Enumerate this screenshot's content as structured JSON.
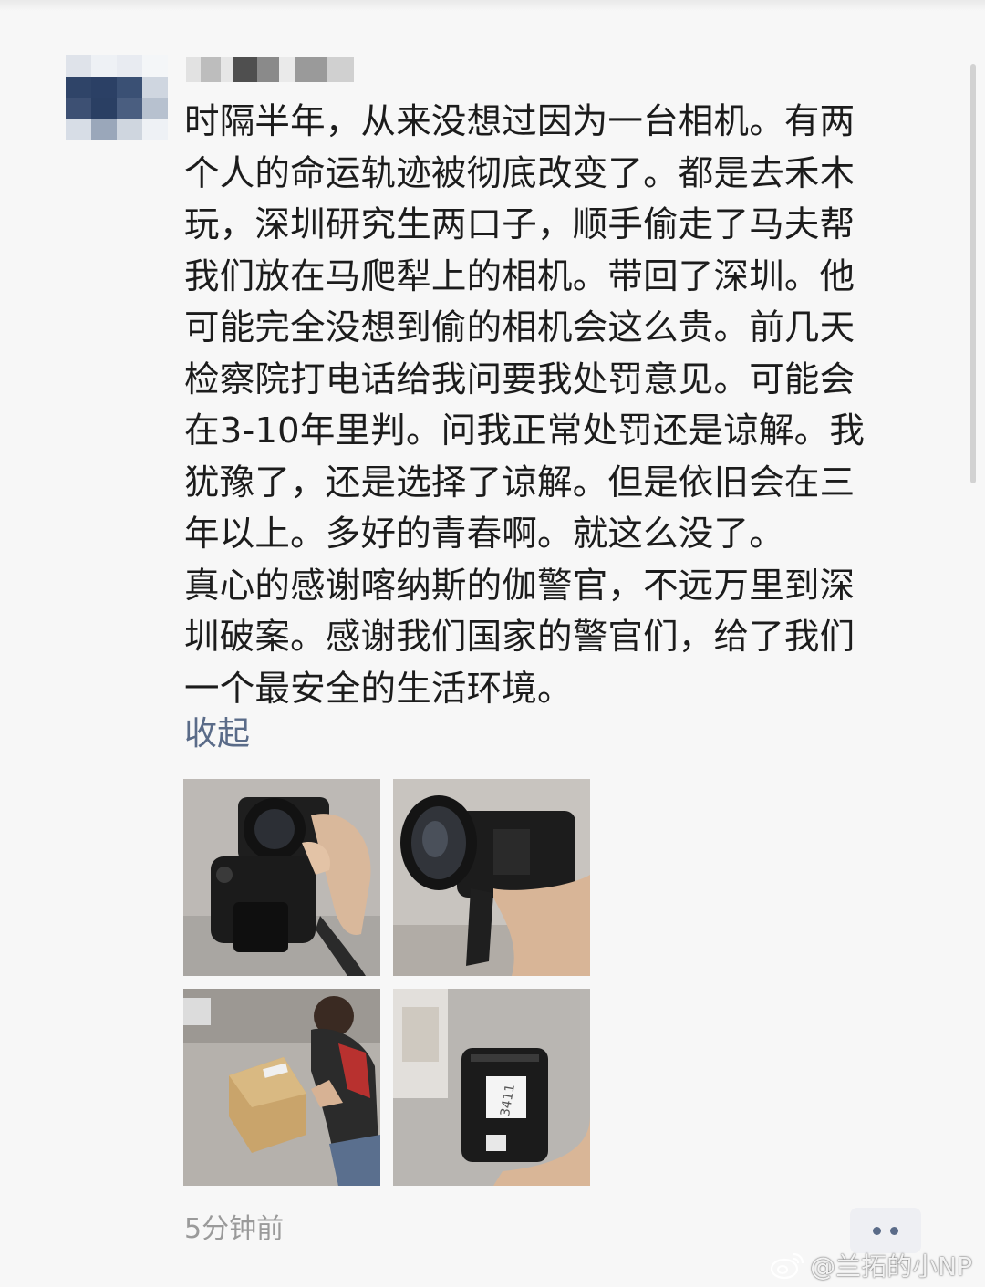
{
  "post": {
    "text": "时隔半年，从来没想过因为一台相机。有两\n个人的命运轨迹被彻底改变了。都是去禾木\n玩，深圳研究生两口子，顺手偷走了马夫帮\n我们放在马爬犁上的相机。带回了深圳。他\n可能完全没想到偷的相机会这么贵。前几天\n检察院打电话给我问要我处罚意见。可能会\n在3-10年里判。问我正常处罚还是谅解。我\n犹豫了，还是选择了谅解。但是依旧会在三\n年以上。多好的青春啊。就这么没了。\n真心的感谢喀纳斯的伽警官，不远万里到深\n圳破案。感谢我们国家的警官们，给了我们\n一个最安全的生活环境。",
    "collapse_label": "收起",
    "timestamp": "5分钟前",
    "images": [
      {
        "icon": "camera-photo"
      },
      {
        "icon": "camera-lens-photo"
      },
      {
        "icon": "package-photo"
      },
      {
        "icon": "battery-photo"
      }
    ]
  },
  "watermark": {
    "text": "@兰拓的小NP",
    "icon": "weibo-icon"
  },
  "colors": {
    "link": "#5a6b88",
    "text": "#1c1c1c",
    "timestamp": "#9a9a9a",
    "background": "#f7f7f7"
  }
}
